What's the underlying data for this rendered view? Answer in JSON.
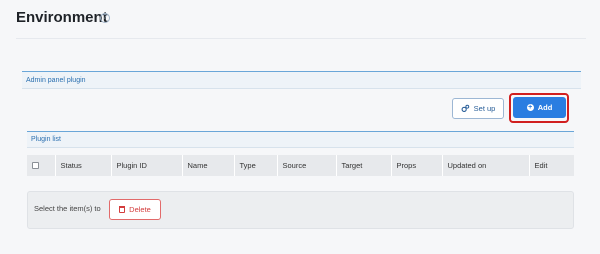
{
  "page": {
    "title": "Environment",
    "help_icon": "question-circle-icon"
  },
  "section": {
    "title": "Admin panel plugin"
  },
  "toolbar": {
    "setup_label": "Set up",
    "setup_icon": "gears-icon",
    "add_label": "Add",
    "add_icon": "plus-circle-icon"
  },
  "plugin_list": {
    "title": "Plugin list",
    "columns": [
      "Status",
      "Plugin ID",
      "Name",
      "Type",
      "Source",
      "Target",
      "Props",
      "Updated on",
      "Edit"
    ]
  },
  "footer": {
    "select_label": "Select the item(s) to",
    "delete_label": "Delete",
    "delete_icon": "trash-icon"
  },
  "colors": {
    "accent": "#2a7de1",
    "highlight_outline": "#d11f1f",
    "section_text": "#2a6fb0",
    "danger": "#d33c3c"
  }
}
